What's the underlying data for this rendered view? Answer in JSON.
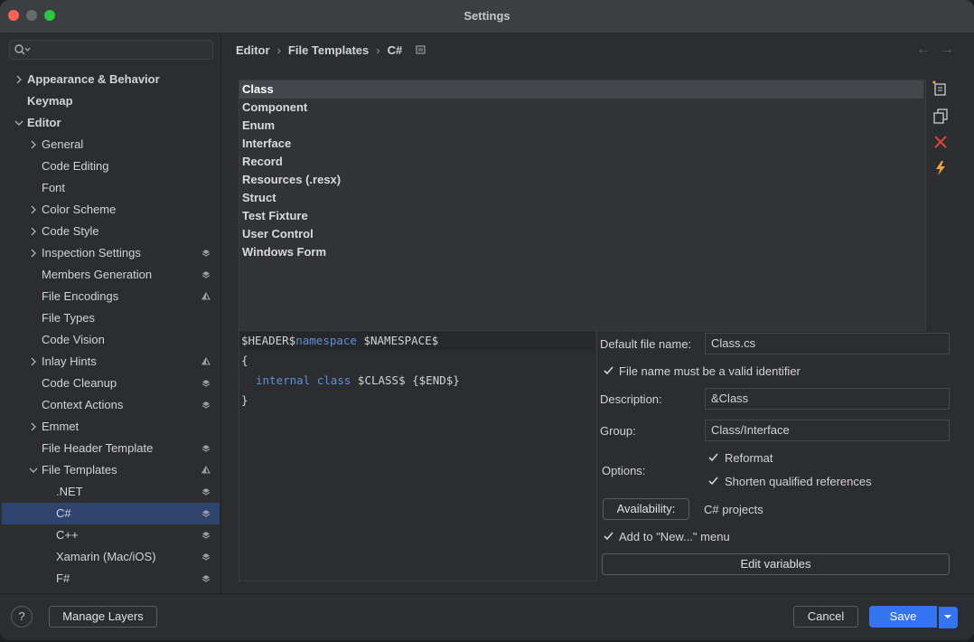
{
  "window": {
    "title": "Settings"
  },
  "search": {
    "placeholder": ""
  },
  "sidebar": {
    "items": [
      {
        "label": "Appearance & Behavior",
        "expandable": true,
        "expanded": false,
        "level": 0,
        "bold": true,
        "layer": ""
      },
      {
        "label": "Keymap",
        "expandable": false,
        "level": 0,
        "bold": true,
        "layer": ""
      },
      {
        "label": "Editor",
        "expandable": true,
        "expanded": true,
        "level": 0,
        "bold": true,
        "layer": ""
      },
      {
        "label": "General",
        "expandable": true,
        "expanded": false,
        "level": 1,
        "layer": ""
      },
      {
        "label": "Code Editing",
        "expandable": false,
        "level": 1,
        "layer": ""
      },
      {
        "label": "Font",
        "expandable": false,
        "level": 1,
        "layer": ""
      },
      {
        "label": "Color Scheme",
        "expandable": true,
        "expanded": false,
        "level": 1,
        "layer": ""
      },
      {
        "label": "Code Style",
        "expandable": true,
        "expanded": false,
        "level": 1,
        "layer": ""
      },
      {
        "label": "Inspection Settings",
        "expandable": true,
        "expanded": false,
        "level": 1,
        "layer": "stack"
      },
      {
        "label": "Members Generation",
        "expandable": false,
        "level": 1,
        "layer": "stack"
      },
      {
        "label": "File Encodings",
        "expandable": false,
        "level": 1,
        "layer": "half"
      },
      {
        "label": "File Types",
        "expandable": false,
        "level": 1,
        "layer": ""
      },
      {
        "label": "Code Vision",
        "expandable": false,
        "level": 1,
        "layer": ""
      },
      {
        "label": "Inlay Hints",
        "expandable": true,
        "expanded": false,
        "level": 1,
        "layer": "half"
      },
      {
        "label": "Code Cleanup",
        "expandable": false,
        "level": 1,
        "layer": "stack"
      },
      {
        "label": "Context Actions",
        "expandable": false,
        "level": 1,
        "layer": "stack"
      },
      {
        "label": "Emmet",
        "expandable": true,
        "expanded": false,
        "level": 1,
        "layer": ""
      },
      {
        "label": "File Header Template",
        "expandable": false,
        "level": 1,
        "layer": "stack"
      },
      {
        "label": "File Templates",
        "expandable": true,
        "expanded": true,
        "level": 1,
        "layer": "half"
      },
      {
        "label": ".NET",
        "expandable": false,
        "level": 2,
        "layer": "stack"
      },
      {
        "label": "C#",
        "expandable": false,
        "level": 2,
        "layer": "stack",
        "selected": true
      },
      {
        "label": "C++",
        "expandable": false,
        "level": 2,
        "layer": "stack"
      },
      {
        "label": "Xamarin (Mac/iOS)",
        "expandable": false,
        "level": 2,
        "layer": "stack"
      },
      {
        "label": "F#",
        "expandable": false,
        "level": 2,
        "layer": "stack"
      }
    ]
  },
  "breadcrumb": {
    "items": [
      "Editor",
      "File Templates",
      "C#"
    ],
    "separator": "›"
  },
  "templates": {
    "items": [
      "Class",
      "Component",
      "Enum",
      "Interface",
      "Record",
      "Resources (.resx)",
      "Struct",
      "Test Fixture",
      "User Control",
      "Windows Form"
    ],
    "selected": "Class"
  },
  "toolbar": {
    "icons": [
      "add-template-icon",
      "copy-template-icon",
      "remove-template-icon",
      "reset-template-icon"
    ]
  },
  "editor": {
    "line1_a": "$HEADER$",
    "line1_kw": "namespace",
    "line1_b": " $NAMESPACE$",
    "line2": "{",
    "line3_kw1": "internal",
    "line3_kw2": "class",
    "line3_rest": " $CLASS$ {$END$}",
    "line4": "}"
  },
  "props": {
    "default_file_name_label": "Default file name:",
    "default_file_name_value": "Class.cs",
    "valid_identifier_label": "File name must be a valid identifier",
    "valid_identifier_checked": true,
    "description_label": "Description:",
    "description_value": "&Class",
    "group_label": "Group:",
    "group_value": "Class/Interface",
    "options_label": "Options:",
    "reformat_label": "Reformat",
    "reformat_checked": true,
    "shorten_label": "Shorten qualified references",
    "shorten_checked": true,
    "availability_button": "Availability:",
    "availability_value": "C# projects",
    "add_to_new_label": "Add to \"New...\" menu",
    "add_to_new_checked": true,
    "edit_variables_button": "Edit variables"
  },
  "footer": {
    "help_label": "?",
    "manage_layers_label": "Manage Layers",
    "cancel_label": "Cancel",
    "save_label": "Save"
  },
  "colors": {
    "accent": "#3574f0",
    "selection": "#2e436e",
    "keyword": "#5f8fd8",
    "remove": "#e0453a",
    "lightning": "#f0a732"
  }
}
